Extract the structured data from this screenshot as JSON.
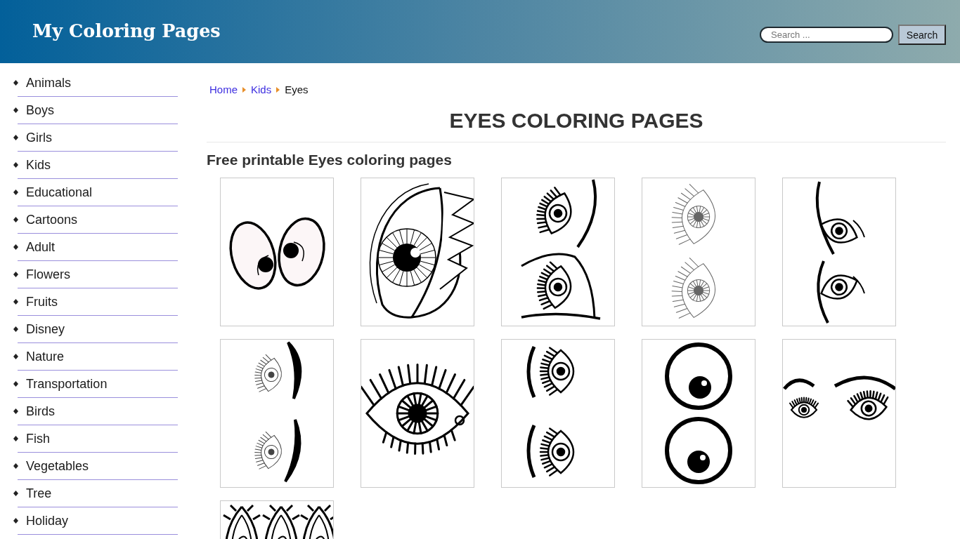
{
  "header": {
    "site_title": "My Coloring Pages",
    "search": {
      "placeholder": "Search ...",
      "button": "Search"
    }
  },
  "sidebar": {
    "items": [
      "Animals",
      "Boys",
      "Girls",
      "Kids",
      "Educational",
      "Cartoons",
      "Adult",
      "Flowers",
      "Fruits",
      "Disney",
      "Nature",
      "Transportation",
      "Birds",
      "Fish",
      "Vegetables",
      "Tree",
      "Holiday"
    ]
  },
  "breadcrumb": [
    {
      "label": "Home",
      "current": false
    },
    {
      "label": "Kids",
      "current": false
    },
    {
      "label": "Eyes",
      "current": true
    }
  ],
  "page_title": "EYES COLORING PAGES",
  "subtitle": "Free printable Eyes coloring pages",
  "thumbnails": [
    {
      "kind": "cartoon-pair"
    },
    {
      "kind": "spiky-eye"
    },
    {
      "kind": "side-eyes"
    },
    {
      "kind": "sketch-eyes"
    },
    {
      "kind": "brow-eyes"
    },
    {
      "kind": "shaded-eyes"
    },
    {
      "kind": "detailed-eye"
    },
    {
      "kind": "lash-eyes"
    },
    {
      "kind": "googly-eyes"
    },
    {
      "kind": "brow-pair"
    },
    {
      "kind": "peacock-eyes"
    }
  ]
}
